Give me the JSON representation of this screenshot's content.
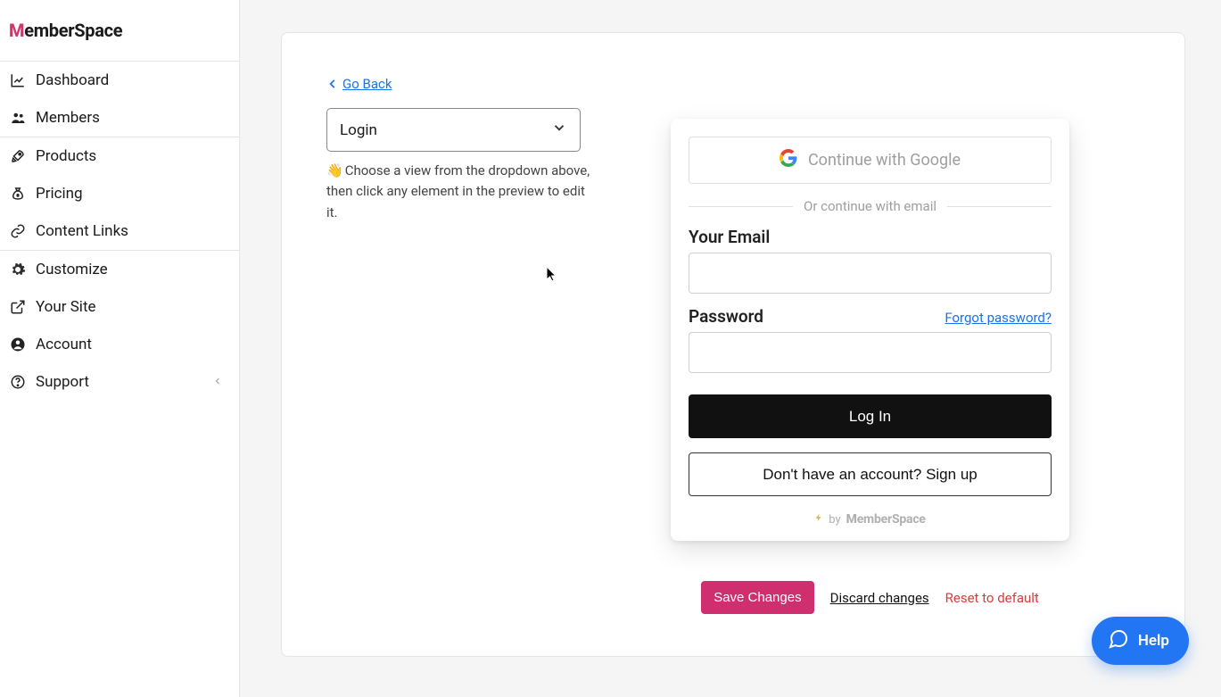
{
  "logo_text": "MemberSpace",
  "sidebar": {
    "groups": [
      {
        "items": [
          {
            "label": "Dashboard"
          },
          {
            "label": "Members"
          }
        ]
      },
      {
        "items": [
          {
            "label": "Products"
          },
          {
            "label": "Pricing"
          },
          {
            "label": "Content Links"
          }
        ]
      },
      {
        "items": [
          {
            "label": "Customize"
          },
          {
            "label": "Your Site"
          },
          {
            "label": "Account"
          },
          {
            "label": "Support"
          }
        ]
      }
    ]
  },
  "editor": {
    "go_back": "Go Back",
    "view_selected": "Login",
    "helper_emoji": "👋",
    "helper_text": "Choose a view from the dropdown above, then click any element in the preview to edit it."
  },
  "login_preview": {
    "google_button": "Continue with Google",
    "divider_text": "Or continue with email",
    "email_label": "Your Email",
    "password_label": "Password",
    "forgot_password": "Forgot password?",
    "login_button": "Log In",
    "signup_button": "Don't have an account? Sign up",
    "footer_by": "by",
    "footer_brand": "MemberSpace"
  },
  "actions": {
    "save": "Save Changes",
    "discard": "Discard changes",
    "reset": "Reset to default"
  },
  "help_label": "Help",
  "colors": {
    "accent_pink": "#cf2e6f",
    "link_blue": "#1a73e8",
    "danger": "#d93b3b",
    "help_blue": "#2376f3"
  }
}
